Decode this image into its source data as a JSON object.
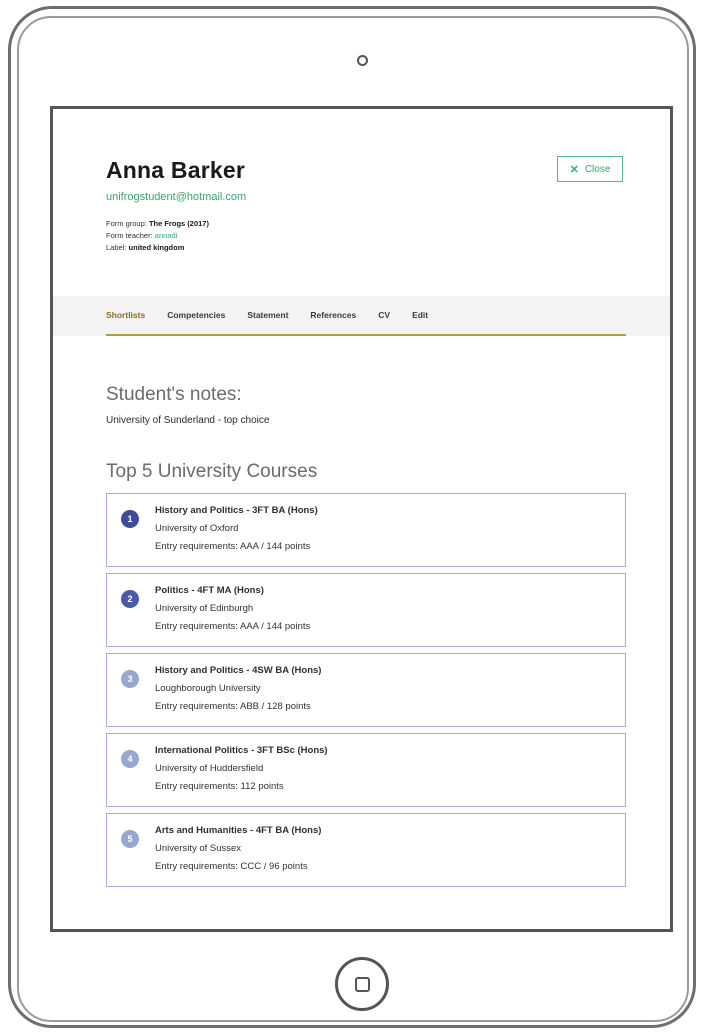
{
  "student": {
    "name": "Anna Barker",
    "email": "unifrogstudent@hotmail.com",
    "form_group_label": "Form group:",
    "form_group_value": "The Frogs (2017)",
    "form_teacher_label": "Form teacher:",
    "form_teacher_value": "annadi",
    "label_label": "Label:",
    "label_value": "united kingdom"
  },
  "close_button": {
    "icon": "close-icon",
    "icon_glyph": "✕",
    "label": "Close"
  },
  "tabs": [
    {
      "label": "Shortlists",
      "active": true
    },
    {
      "label": "Competencies",
      "active": false
    },
    {
      "label": "Statement",
      "active": false
    },
    {
      "label": "References",
      "active": false
    },
    {
      "label": "CV",
      "active": false
    },
    {
      "label": "Edit",
      "active": false
    }
  ],
  "notes": {
    "heading": "Student's notes:",
    "text": "University of Sunderland - top choice"
  },
  "courses_section": {
    "heading": "Top 5 University Courses",
    "items": [
      {
        "rank": "1",
        "title": "History and Politics - 3FT BA (Hons)",
        "university": "University of Oxford",
        "requirements": "Entry requirements: AAA / 144 points",
        "badge_color": "#3e4c9a"
      },
      {
        "rank": "2",
        "title": "Politics - 4FT MA (Hons)",
        "university": "University of Edinburgh",
        "requirements": "Entry requirements: AAA / 144 points",
        "badge_color": "#4a5aa8"
      },
      {
        "rank": "3",
        "title": "History and Politics - 4SW BA (Hons)",
        "university": "Loughborough University",
        "requirements": "Entry requirements: ABB / 128 points",
        "badge_color": "#9aa6d2"
      },
      {
        "rank": "4",
        "title": "International Politics - 3FT BSc (Hons)",
        "university": "University of Huddersfield",
        "requirements": "Entry requirements: 112 points",
        "badge_color": "#9aa6d2"
      },
      {
        "rank": "5",
        "title": "Arts and Humanities - 4FT BA (Hons)",
        "university": "University of Sussex",
        "requirements": "Entry requirements: CCC / 96 points",
        "badge_color": "#9aa6d2"
      }
    ]
  },
  "colors": {
    "accent_green": "#3aa66a",
    "tab_underline": "#b49a4c",
    "card_border": "#a8abd6"
  }
}
